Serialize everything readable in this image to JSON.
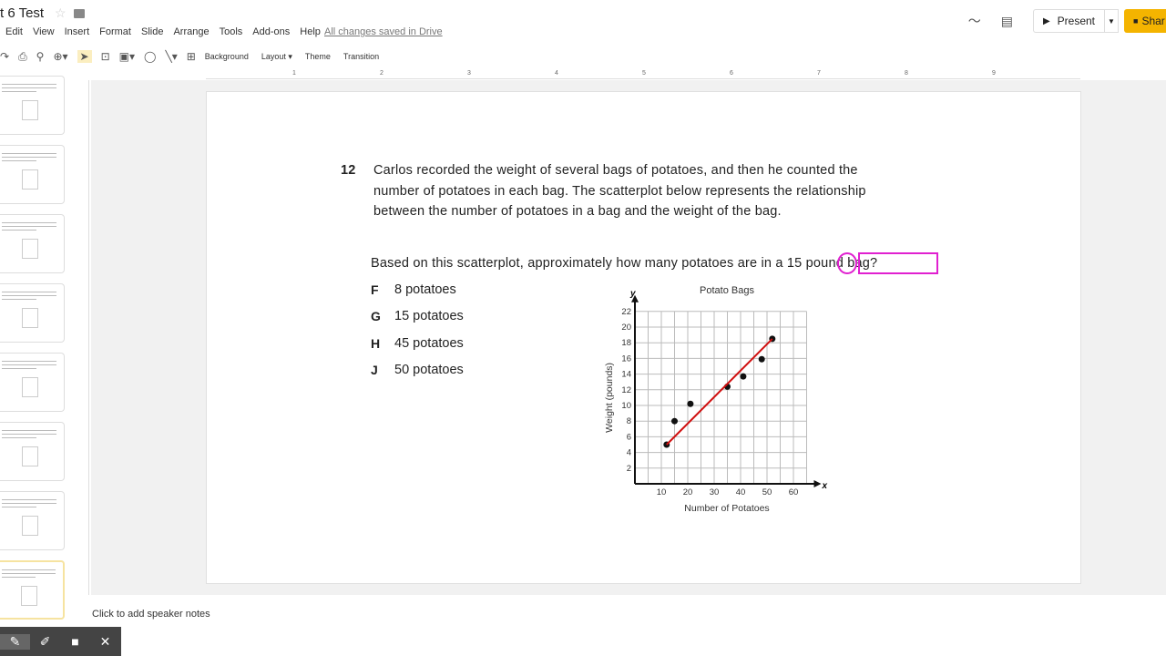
{
  "app": {
    "title": "t 6 Test",
    "saved": "All changes saved in Drive"
  },
  "menu": [
    "Edit",
    "View",
    "Insert",
    "Format",
    "Slide",
    "Arrange",
    "Tools",
    "Add-ons",
    "Help"
  ],
  "header": {
    "present": "Present",
    "share": "Shar"
  },
  "toolbar": {
    "background": "Background",
    "layout": "Layout ▾",
    "theme": "Theme",
    "transition": "Transition"
  },
  "ruler": [
    "1",
    "2",
    "3",
    "4",
    "5",
    "6",
    "7",
    "8",
    "9"
  ],
  "slide": {
    "number": "12",
    "lines": [
      "Carlos recorded the weight of several bags of potatoes, and then he counted the",
      "number of potatoes in each bag. The scatterplot below represents the relationship",
      "between the number of potatoes in a bag and the weight of the bag."
    ],
    "prompt": "Based on this scatterplot, approximately how many potatoes are in a 15 pound bag?",
    "options": [
      {
        "letter": "F",
        "text": "8 potatoes"
      },
      {
        "letter": "G",
        "text": "15 potatoes"
      },
      {
        "letter": "H",
        "text": "45 potatoes"
      },
      {
        "letter": "J",
        "text": "50 potatoes"
      }
    ],
    "annotation_color": "#e020d0"
  },
  "chart_data": {
    "type": "scatter",
    "title": "Potato Bags",
    "xlabel": "Number of Potatoes",
    "ylabel": "Weight (pounds)",
    "xaxis_letter": "x",
    "yaxis_letter": "y",
    "xlim": [
      0,
      65
    ],
    "ylim": [
      0,
      22
    ],
    "grid": true,
    "xticks": [
      10,
      20,
      30,
      40,
      50,
      60
    ],
    "yticks": [
      2,
      4,
      6,
      8,
      10,
      12,
      14,
      16,
      18,
      20,
      22
    ],
    "points": [
      [
        12,
        5
      ],
      [
        15,
        8
      ],
      [
        21,
        10.2
      ],
      [
        35,
        12.4
      ],
      [
        41,
        13.7
      ],
      [
        48,
        15.9
      ],
      [
        52,
        18.5
      ]
    ],
    "trend_line": {
      "from": [
        12,
        5
      ],
      "to": [
        52,
        18.5
      ],
      "color": "#d01010"
    }
  },
  "notes": "Click to add speaker notes"
}
